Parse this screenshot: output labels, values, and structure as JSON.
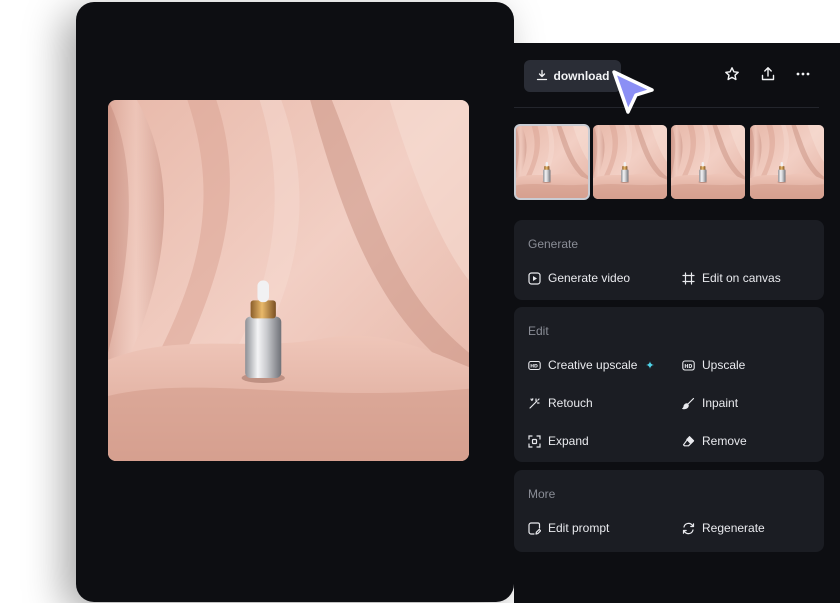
{
  "toolbar": {
    "download_label": "download"
  },
  "icons": {
    "download": "download-icon",
    "favorite": "star-icon",
    "share": "share-upload-icon",
    "more": "more-horizontal-icon"
  },
  "sections": {
    "generate": {
      "title": "Generate",
      "actions": [
        "Generate video",
        "Edit on canvas"
      ]
    },
    "edit": {
      "title": "Edit",
      "actions": [
        "Creative upscale",
        "Upscale",
        "Retouch",
        "Inpaint",
        "Expand",
        "Remove"
      ]
    },
    "more": {
      "title": "More",
      "actions": [
        "Edit prompt",
        "Regenerate"
      ]
    }
  },
  "colors": {
    "panel_bg": "#0d0e12",
    "card_bg": "#1b1d23",
    "accent_cursor": "#8b8ff5",
    "sparkle": "#4fd3e8"
  }
}
